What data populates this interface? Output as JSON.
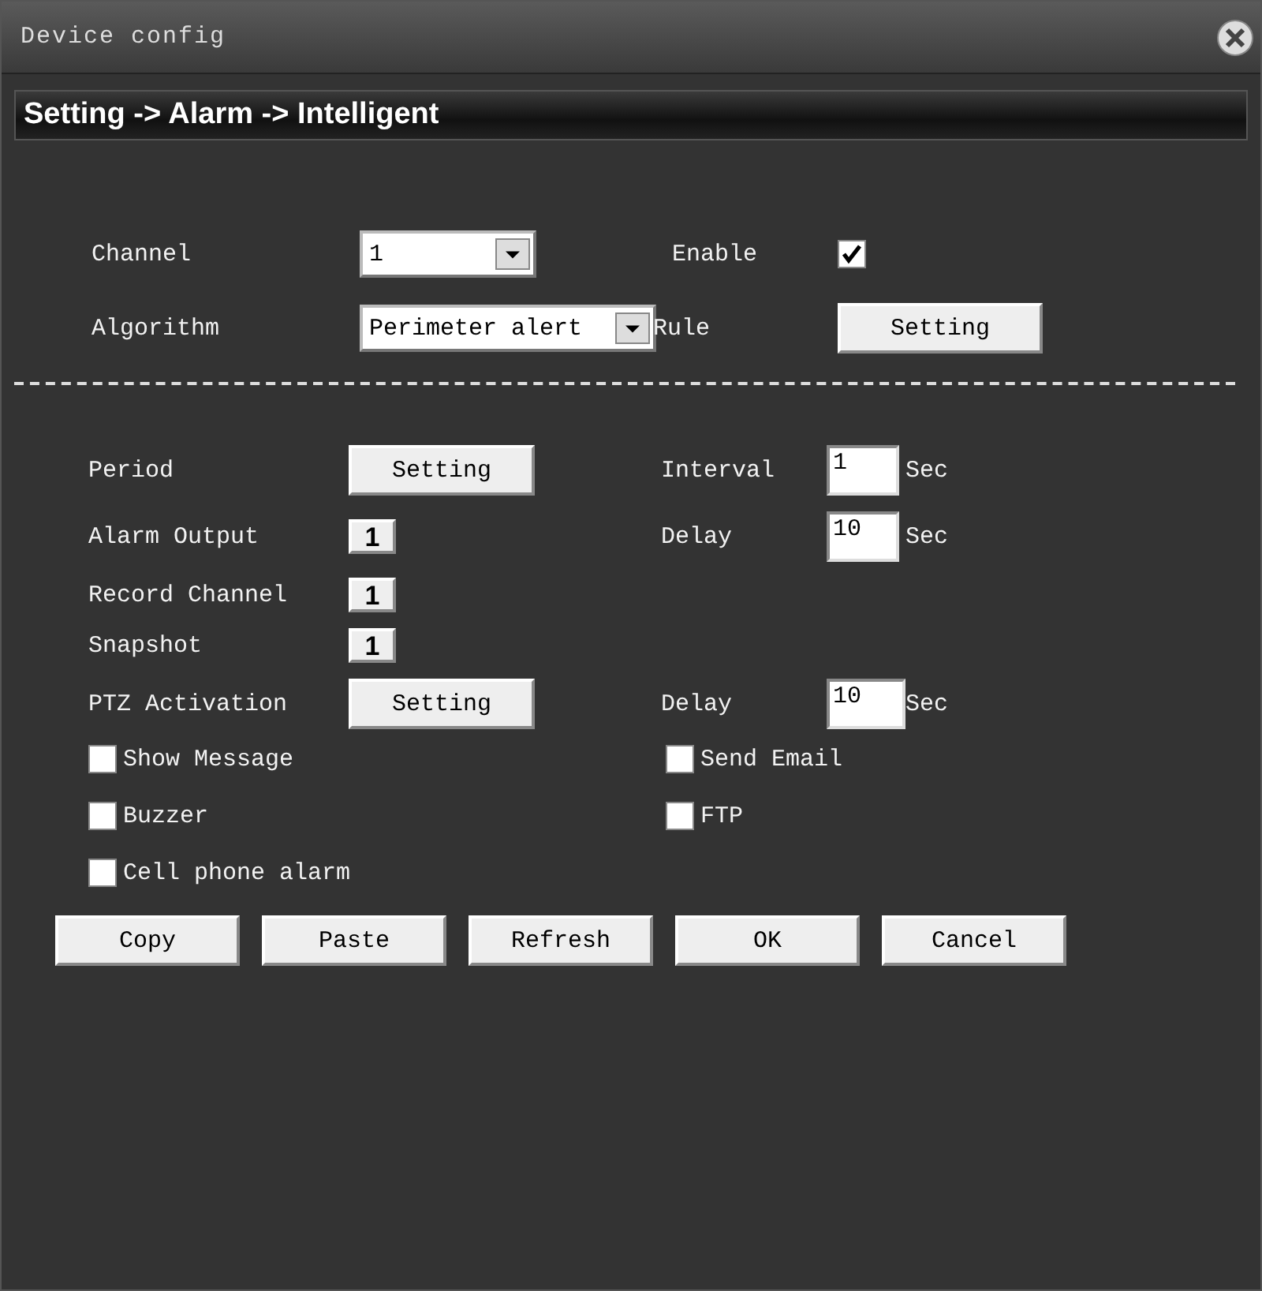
{
  "window": {
    "title": "Device config"
  },
  "breadcrumb": "Setting -> Alarm -> Intelligent",
  "channel": {
    "label": "Channel",
    "value": "1"
  },
  "enable": {
    "label": "Enable",
    "checked": true
  },
  "algorithm": {
    "label": "Algorithm",
    "value": "Perimeter alert"
  },
  "rule": {
    "label": "Rule",
    "button": "Setting"
  },
  "rows": [
    {
      "label": "Period",
      "kind": "button",
      "value": "Setting",
      "right": {
        "label": "Interval",
        "value": "1",
        "unit": "Sec"
      }
    },
    {
      "label": "Alarm Output",
      "kind": "toggle",
      "value": "1",
      "right": {
        "label": "Delay",
        "value": "10",
        "unit": "Sec"
      }
    },
    {
      "label": "Record Channel",
      "kind": "toggle",
      "value": "1"
    },
    {
      "label": "Snapshot",
      "kind": "toggle",
      "value": "1"
    },
    {
      "label": "PTZ Activation",
      "kind": "button",
      "value": "Setting",
      "right": {
        "label": "Delay",
        "value": "10",
        "unit": "Sec"
      }
    }
  ],
  "checkbox_rows": [
    {
      "left": {
        "label": "Show Message",
        "checked": false
      },
      "right": {
        "label": "Send Email",
        "checked": false
      }
    },
    {
      "left": {
        "label": "Buzzer",
        "checked": false
      },
      "right": {
        "label": "FTP",
        "checked": false
      }
    },
    {
      "left": {
        "label": "Cell phone alarm",
        "checked": false
      }
    }
  ],
  "buttons": [
    "Copy",
    "Paste",
    "Refresh",
    "OK",
    "Cancel"
  ]
}
